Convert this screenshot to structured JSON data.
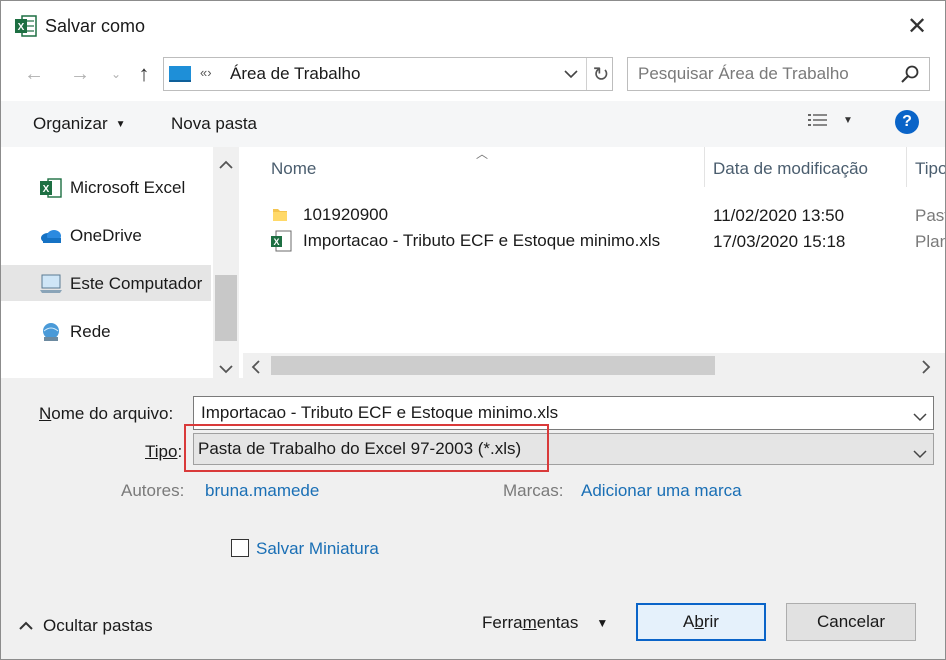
{
  "window": {
    "title": "Salvar como"
  },
  "address": {
    "path": "Área de Trabalho",
    "breadcrumb_sep": "«›"
  },
  "search": {
    "placeholder": "Pesquisar Área de Trabalho"
  },
  "toolbar": {
    "organize": "Organizar",
    "new_folder": "Nova pasta"
  },
  "sidebar": {
    "items": [
      {
        "label": "Microsoft Excel",
        "icon": "excel-icon"
      },
      {
        "label": "OneDrive",
        "icon": "onedrive-cloud-icon"
      },
      {
        "label": "Este Computador",
        "icon": "computer-icon",
        "selected": true
      },
      {
        "label": "Rede",
        "icon": "network-icon"
      }
    ]
  },
  "columns": {
    "name": "Nome",
    "date": "Data de modificação",
    "type": "Tipo"
  },
  "files": [
    {
      "name": "101920900",
      "date": "11/02/2020 13:50",
      "type": "Past",
      "icon": "folder-icon"
    },
    {
      "name": "Importacao - Tributo ECF e Estoque minimo.xls",
      "date": "17/03/2020 15:18",
      "type": "Plan",
      "icon": "excel-file-icon"
    }
  ],
  "form": {
    "filename_label_prefix": "N",
    "filename_label_rest": "ome do arquivo:",
    "filename_value": "Importacao - Tributo ECF e Estoque minimo.xls",
    "type_label_prefix": "Tipo",
    "type_label_rest": ":",
    "type_value": "Pasta de Trabalho do Excel 97-2003 (*.xls)",
    "authors_label": "Autores:",
    "authors_value": "bruna.mamede",
    "tags_label": "Marcas:",
    "tags_value": "Adicionar uma marca",
    "thumbnail_label": "Salvar Miniatura"
  },
  "footer": {
    "hide_folders": "Ocultar pastas",
    "tools_prefix": "Ferra",
    "tools_underline": "m",
    "tools_rest": "entas",
    "open_prefix": "A",
    "open_underline": "b",
    "open_rest": "rir",
    "cancel": "Cancelar"
  },
  "colors": {
    "highlight_box": "#d93a3a",
    "accent": "#0a64c8",
    "excel_green": "#1d6f42"
  }
}
